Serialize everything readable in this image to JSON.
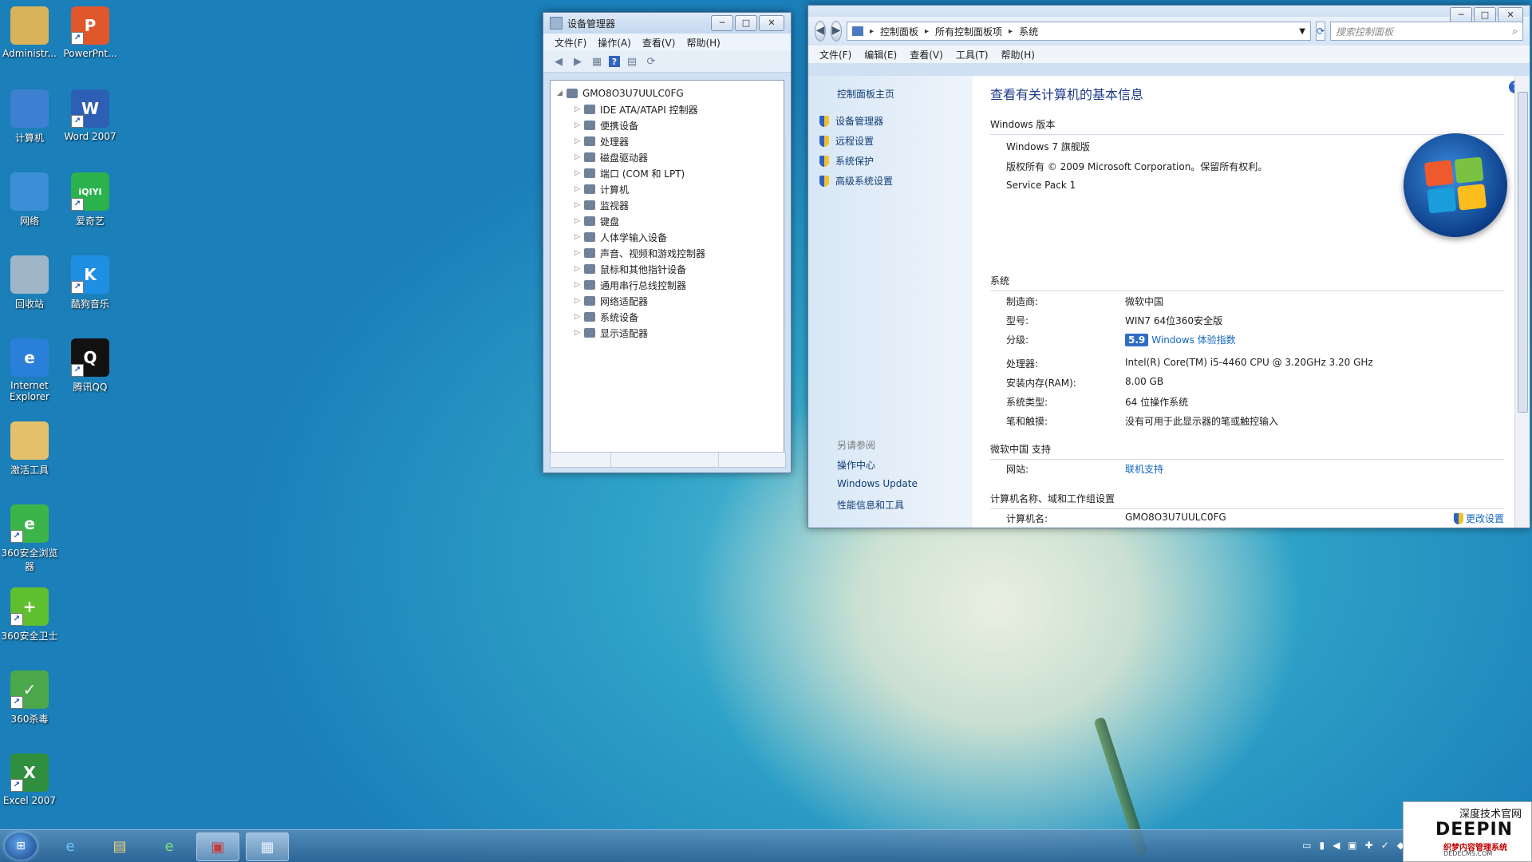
{
  "desktop": {
    "icons": [
      {
        "label": "Administr...",
        "icon": "user-folder-icon",
        "color": "#d8b35a",
        "glyph": "",
        "shortcut": false
      },
      {
        "label": "PowerPnt...",
        "icon": "powerpoint-icon",
        "color": "#e0572b",
        "glyph": "P",
        "shortcut": true
      },
      {
        "label": "计算机",
        "icon": "computer-icon",
        "color": "#3d7fd1",
        "glyph": "",
        "shortcut": false
      },
      {
        "label": "Word 2007",
        "icon": "word-icon",
        "color": "#2d5fb5",
        "glyph": "W",
        "shortcut": true
      },
      {
        "label": "网络",
        "icon": "network-icon",
        "color": "#3a8fd6",
        "glyph": "",
        "shortcut": false
      },
      {
        "label": "爱奇艺",
        "icon": "iqiyi-icon",
        "color": "#2bb24c",
        "glyph": "iQIYI",
        "shortcut": true
      },
      {
        "label": "回收站",
        "icon": "recycle-bin-icon",
        "color": "#9fb6c9",
        "glyph": "",
        "shortcut": false
      },
      {
        "label": "酷狗音乐",
        "icon": "kugou-icon",
        "color": "#1f8fe3",
        "glyph": "K",
        "shortcut": true
      },
      {
        "label": "Internet Explorer",
        "icon": "ie-icon",
        "color": "#2a7fd8",
        "glyph": "e",
        "shortcut": false
      },
      {
        "label": "腾讯QQ",
        "icon": "qq-icon",
        "color": "#111111",
        "glyph": "Q",
        "shortcut": true
      },
      {
        "label": "激活工具",
        "icon": "folder-icon",
        "color": "#e4c06a",
        "glyph": "",
        "shortcut": false
      },
      {
        "label": "360安全浏览器",
        "icon": "browser-360-icon",
        "color": "#3bb54a",
        "glyph": "e",
        "shortcut": true
      },
      {
        "label": "360安全卫士",
        "icon": "security-360-icon",
        "color": "#5fbf2f",
        "glyph": "+",
        "shortcut": true
      },
      {
        "label": "360杀毒",
        "icon": "antivirus-360-icon",
        "color": "#4aa84a",
        "glyph": "✓",
        "shortcut": true
      },
      {
        "label": "Excel 2007",
        "icon": "excel-icon",
        "color": "#2f8f3f",
        "glyph": "X",
        "shortcut": true
      }
    ]
  },
  "device_manager": {
    "title": "设备管理器",
    "menu": [
      "文件(F)",
      "操作(A)",
      "查看(V)",
      "帮助(H)"
    ],
    "root": "GMO8O3U7UULC0FG",
    "items": [
      "IDE ATA/ATAPI 控制器",
      "便携设备",
      "处理器",
      "磁盘驱动器",
      "端口 (COM 和 LPT)",
      "计算机",
      "监视器",
      "键盘",
      "人体学输入设备",
      "声音、视频和游戏控制器",
      "鼠标和其他指针设备",
      "通用串行总线控制器",
      "网络适配器",
      "系统设备",
      "显示适配器"
    ]
  },
  "system_window": {
    "address": {
      "crumbs": [
        "控制面板",
        "所有控制面板项",
        "系统"
      ]
    },
    "search_placeholder": "搜索控制面板",
    "menu": [
      "文件(F)",
      "编辑(E)",
      "查看(V)",
      "工具(T)",
      "帮助(H)"
    ],
    "left": {
      "home": "控制面板主页",
      "links": [
        "设备管理器",
        "远程设置",
        "系统保护",
        "高级系统设置"
      ],
      "see_also_title": "另请参阅",
      "see_also": [
        "操作中心",
        "Windows Update",
        "性能信息和工具"
      ]
    },
    "main_title": "查看有关计算机的基本信息",
    "edition": {
      "section": "Windows 版本",
      "name": "Windows 7 旗舰版",
      "copyright": "版权所有 © 2009 Microsoft Corporation。保留所有权利。",
      "sp": "Service Pack 1"
    },
    "system": {
      "section": "系统",
      "rows": [
        {
          "label": "制造商:",
          "value": "微软中国"
        },
        {
          "label": "型号:",
          "value": "WIN7 64位360安全版"
        },
        {
          "label": "分级:",
          "value": "Windows 体验指数",
          "badge": "5.9"
        },
        {
          "label": "处理器:",
          "value": "Intel(R) Core(TM) i5-4460  CPU @ 3.20GHz   3.20 GHz"
        },
        {
          "label": "安装内存(RAM):",
          "value": "8.00 GB"
        },
        {
          "label": "系统类型:",
          "value": "64 位操作系统"
        },
        {
          "label": "笔和触摸:",
          "value": "没有可用于此显示器的笔或触控输入"
        }
      ]
    },
    "support": {
      "section": "微软中国 支持",
      "label": "网站:",
      "value": "联机支持"
    },
    "computer": {
      "section": "计算机名称、域和工作组设置",
      "label": "计算机名:",
      "value": "GMO8O3U7UULC0FG",
      "change": "更改设置"
    }
  },
  "watermark": {
    "top": "深度技术官网",
    "big": "DEEPIN",
    "sub": "织梦内容管理系统",
    "url": "DEDECMS.COM"
  }
}
